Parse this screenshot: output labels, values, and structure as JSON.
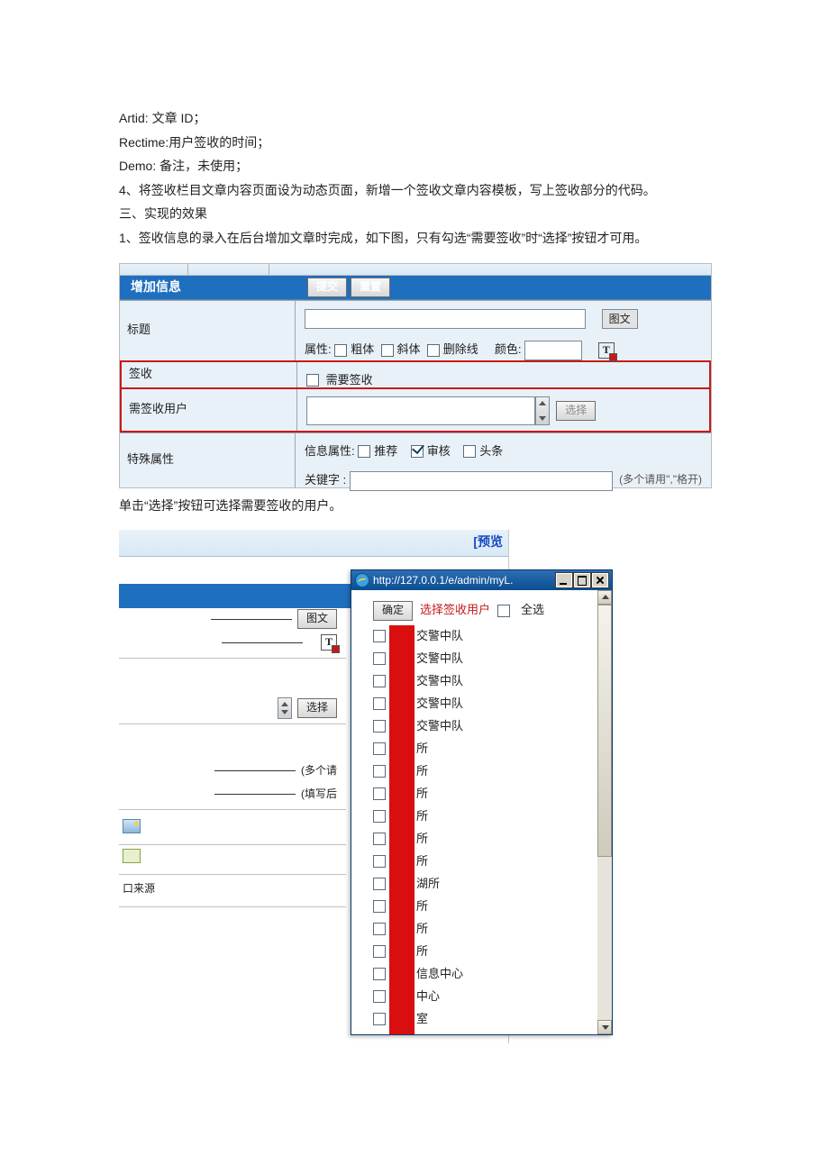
{
  "doc": {
    "line1": "Artid: 文章  ID；",
    "line2": "Rectime:用户签收的时间；",
    "line3": "Demo: 备注，未使用；",
    "line4": "4、将签收栏目文章内容页面设为动态页面，新增一个签收文章内容模板，写上签收部分的代码。",
    "heading2": "三、实现的效果",
    "line5": "1、签收信息的录入在后台增加文章时完成，如下图，只有勾选“需要签收”时“选择”按钮才可用。",
    "line6": "单击“选择”按钮可选择需要签收的用户。"
  },
  "form": {
    "header_left": "增加信息",
    "btn_submit": "提交",
    "btn_reset": "重置",
    "row_title": "标题",
    "tuwen": "图文",
    "attr_label": "属性:",
    "attr_bold": "粗体",
    "attr_italic": "斜体",
    "attr_strike": "删除线",
    "color_label": "颜色:",
    "T_icon": "T",
    "row_sign": "签收",
    "need_sign": "需要签收",
    "row_signusers": "需签收用户",
    "btn_select": "选择",
    "row_special": "特殊属性",
    "infoattr_label": "信息属性:",
    "infoattr_rec": "推荐",
    "infoattr_audit": "审核",
    "infoattr_top": "头条",
    "keywords_label": "关键字   :",
    "keywords_hint": "(多个请用\",\"格开)"
  },
  "shot2": {
    "preview": "[预览",
    "tuwen": "图文",
    "T_icon": "T",
    "btn_select": "选择",
    "hint1": "(多个请",
    "hint2": "(填写后",
    "src_tail": "口来源"
  },
  "popup": {
    "url": "http://127.0.0.1/e/admin/myL.",
    "btn_ok": "确定",
    "head_text": "选择签收用户",
    "select_all": "全选",
    "items": [
      "交警中队",
      "交警中队",
      "交警中队",
      "交警中队",
      "交警中队",
      "所",
      "所",
      "所",
      "所",
      "所",
      "所",
      "湖所",
      "所",
      "所",
      "所",
      "信息中心",
      "中心",
      "室"
    ]
  }
}
